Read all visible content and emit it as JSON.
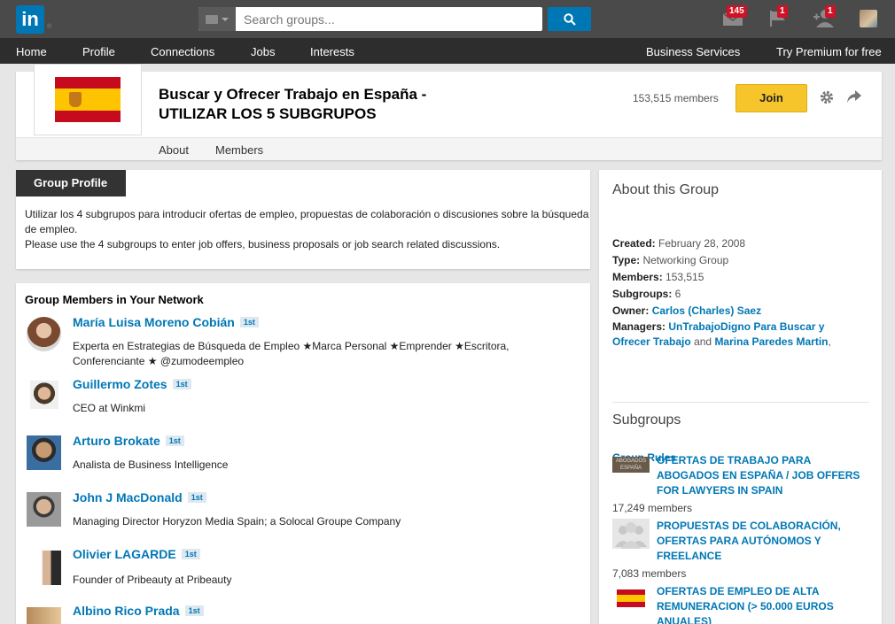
{
  "topbar": {
    "logo_text": "in",
    "search_placeholder": "Search groups...",
    "notifications": {
      "messages": "145",
      "flag": "1",
      "people": "1"
    }
  },
  "nav": {
    "items": [
      "Home",
      "Profile",
      "Connections",
      "Jobs",
      "Interests"
    ],
    "right": [
      "Business Services",
      "Try Premium for free"
    ]
  },
  "group": {
    "title": "Buscar y Ofrecer Trabajo en España - UTILIZAR LOS 5 SUBGRUPOS",
    "members": "153,515 members",
    "join_label": "Join",
    "tabs": [
      "About",
      "Members"
    ]
  },
  "profile": {
    "tag": "Group Profile",
    "line1": "Utilizar los 4 subgrupos para introducir ofertas de empleo, propuestas de colaboración o discusiones sobre la búsqueda de empleo.",
    "line2": "Please use the 4 subgroups to enter job offers, business proposals or job search related discussions."
  },
  "network": {
    "title": "Group Members in Your Network",
    "members": [
      {
        "name": "María Luisa Moreno Cobián",
        "degree": "1st",
        "desc": "Experta en Estrategias de Búsqueda de Empleo ★Marca Personal ★Emprender ★Escritora, Conferenciante ★ @zumodeempleo"
      },
      {
        "name": "Guillermo Zotes",
        "degree": "1st",
        "desc": "CEO at Winkmi"
      },
      {
        "name": "Arturo Brokate",
        "degree": "1st",
        "desc": "Analista de Business Intelligence"
      },
      {
        "name": "John J MacDonald",
        "degree": "1st",
        "desc": "Managing Director Horyzon Media Spain; a Solocal Groupe Company"
      },
      {
        "name": "Olivier LAGARDE",
        "degree": "1st",
        "desc": "Founder of Pribeauty at Pribeauty"
      },
      {
        "name": "Albino Rico Prada",
        "degree": "1st",
        "desc": ""
      }
    ]
  },
  "about": {
    "title": "About this Group",
    "created_label": "Created:",
    "created": "February 28, 2008",
    "type_label": "Type:",
    "type": "Networking Group",
    "members_label": "Members:",
    "members": "153,515",
    "subgroups_label": "Subgroups:",
    "subgroups": "6",
    "owner_label": "Owner:",
    "owner": "Carlos (Charles) Saez",
    "managers_label": "Managers:",
    "manager1": "UnTrabajoDigno Para Buscar y Ofrecer Trabajo",
    "managers_and": "and",
    "manager2": "Marina Paredes Martin",
    "rules": "Group Rules"
  },
  "subgroups": {
    "title": "Subgroups",
    "items": [
      {
        "name": "OFERTAS DE TRABAJO PARA ABOGADOS EN ESPAÑA / JOB OFFERS FOR LAWYERS IN SPAIN",
        "count": "17,249 members",
        "thumb_text": "ABOGADOS ESPAÑA"
      },
      {
        "name": "PROPUESTAS DE COLABORACIÓN, OFERTAS PARA AUTÓNOMOS Y FREELANCE",
        "count": "7,083 members"
      },
      {
        "name": "OFERTAS DE EMPLEO DE ALTA REMUNERACION (> 50.000 EUROS ANUALES)",
        "count": ""
      }
    ]
  }
}
